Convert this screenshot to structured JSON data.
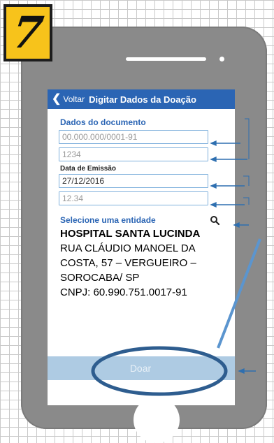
{
  "step_badge": "7",
  "navbar": {
    "back_label": "Voltar",
    "title": "Digitar Dados da Doação"
  },
  "form": {
    "section_title": "Dados do documento",
    "cnpj_value": "00.000.000/0001-91",
    "number_value": "1234",
    "date_label": "Data de Emissão",
    "date_value": "27/12/2016",
    "amount_value": "12.34"
  },
  "entity": {
    "section_title": "Selecione uma entidade",
    "name": "HOSPITAL SANTA LUCINDA",
    "address_lines": [
      "RUA CLÁUDIO MANOEL DA",
      "COSTA, 57 – VERGUEIRO –",
      "SOROCABA/ SP",
      "CNPJ: 60.990.751.0017-91"
    ]
  },
  "doar_button": "Doar",
  "colors": {
    "badge": "#f7c31b",
    "phone": "#8a8a8a",
    "navbar": "#2b65b4",
    "field_border": "#7fb0dc",
    "doar_bar": "#aecbe3",
    "annotation": "#2e6fb0"
  },
  "icons": {
    "back": "chevron-left-icon",
    "entity_search": "search-key-icon"
  }
}
